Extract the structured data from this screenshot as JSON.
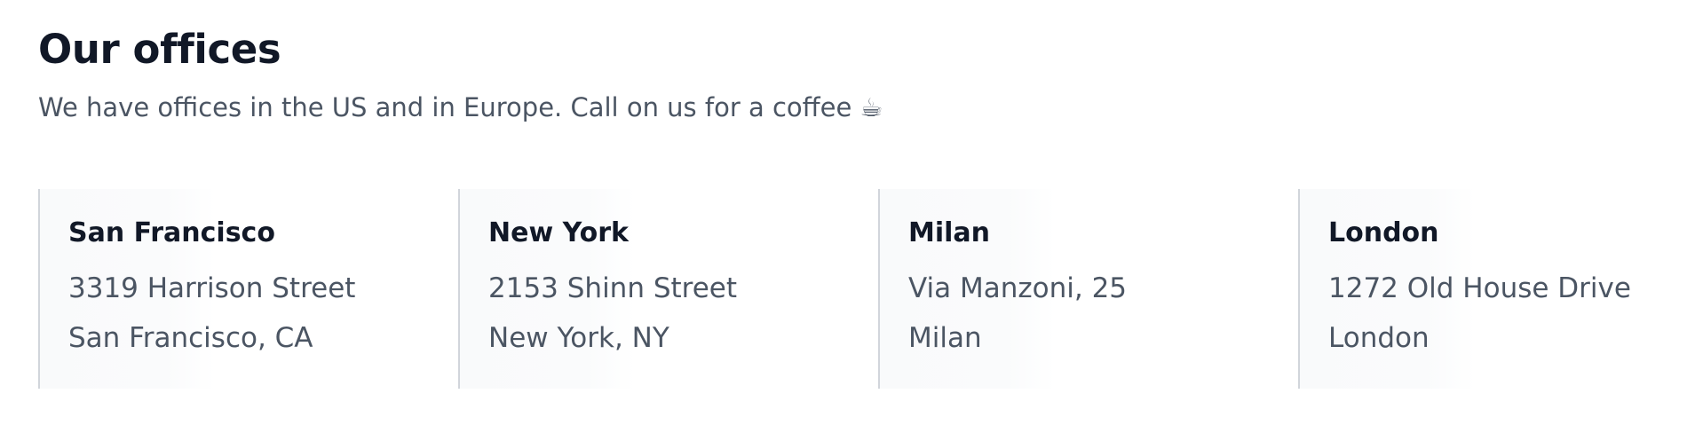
{
  "header": {
    "title": "Our offices",
    "subtitle": "We have offices in the US and in Europe. Call on us for a coffee ☕"
  },
  "offices": [
    {
      "name": "San Francisco",
      "line1": "3319 Harrison Street",
      "line2": "San Francisco, CA"
    },
    {
      "name": "New York",
      "line1": "2153 Shinn Street",
      "line2": "New York, NY"
    },
    {
      "name": "Milan",
      "line1": "Via Manzoni, 25",
      "line2": "Milan"
    },
    {
      "name": "London",
      "line1": "1272 Old House Drive",
      "line2": "London"
    }
  ],
  "colors": {
    "heading": "#111827",
    "body_text": "#4b5563",
    "card_border": "#d1d5db",
    "card_background": "#f9fafb"
  }
}
